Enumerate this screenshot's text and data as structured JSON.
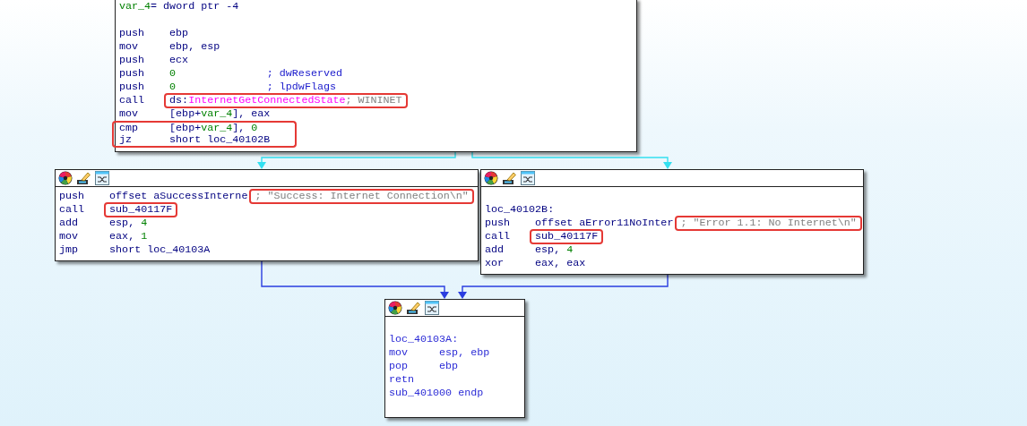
{
  "graph": {
    "blocks": [
      {
        "toolbar": false,
        "highlighted": false,
        "lines": [
          {
            "kind": "text",
            "tokens": [
              {
                "t": "var_4",
                "kind": "var"
              },
              {
                "t": "= dword ptr -4",
                "kind": "plain"
              }
            ]
          },
          {
            "kind": "blank"
          },
          {
            "kind": "instr",
            "mnemonic": "push",
            "operands": [
              {
                "t": "ebp",
                "kind": "plain"
              }
            ]
          },
          {
            "kind": "instr",
            "mnemonic": "mov",
            "operands": [
              {
                "t": "ebp, esp",
                "kind": "plain"
              }
            ]
          },
          {
            "kind": "instr",
            "mnemonic": "push",
            "operands": [
              {
                "t": "ecx",
                "kind": "plain"
              }
            ]
          },
          {
            "kind": "instr",
            "mnemonic": "push",
            "operands": [
              {
                "t": "0",
                "kind": "num"
              }
            ],
            "comment": {
              "t": "; dwReserved",
              "kind": "comment"
            }
          },
          {
            "kind": "instr",
            "mnemonic": "push",
            "operands": [
              {
                "t": "0",
                "kind": "num"
              }
            ],
            "comment": {
              "t": "; lpdwFlags",
              "kind": "comment"
            }
          },
          {
            "kind": "instr",
            "mnemonic": "call",
            "operands": [
              {
                "t": "ds:",
                "kind": "plain"
              },
              {
                "t": "InternetGetConnectedState",
                "kind": "import"
              }
            ],
            "comment": {
              "t": "; WININET",
              "kind": "gray"
            },
            "boxed_operands": true,
            "boxed_comment": true
          },
          {
            "kind": "instr",
            "mnemonic": "mov",
            "operands": [
              {
                "t": "[ebp+",
                "kind": "plain"
              },
              {
                "t": "var_4",
                "kind": "var"
              },
              {
                "t": "], eax",
                "kind": "plain"
              }
            ]
          },
          {
            "kind": "instr",
            "mnemonic": "cmp",
            "operands": [
              {
                "t": "[ebp+",
                "kind": "plain"
              },
              {
                "t": "var_4",
                "kind": "var"
              },
              {
                "t": "], ",
                "kind": "plain"
              },
              {
                "t": "0",
                "kind": "num"
              }
            ],
            "boxed_line": true
          },
          {
            "kind": "instr",
            "mnemonic": "jz",
            "operands": [
              {
                "t": "short loc_40102B",
                "kind": "plain"
              }
            ],
            "boxed_line": true
          }
        ]
      },
      {
        "toolbar": true,
        "highlighted": false,
        "lines": [
          {
            "kind": "instr",
            "mnemonic": "push",
            "operands": [
              {
                "t": "offset aSuccessInterne",
                "kind": "plain"
              }
            ],
            "comment": {
              "t": "; \"Success: Internet Connection\\n\"",
              "kind": "gray"
            },
            "boxed_comment": true
          },
          {
            "kind": "instr",
            "mnemonic": "call",
            "operands": [
              {
                "t": "sub_40117F",
                "kind": "plain"
              }
            ],
            "boxed_operands": true
          },
          {
            "kind": "instr",
            "mnemonic": "add",
            "operands": [
              {
                "t": "esp, ",
                "kind": "plain"
              },
              {
                "t": "4",
                "kind": "num"
              }
            ]
          },
          {
            "kind": "instr",
            "mnemonic": "mov",
            "operands": [
              {
                "t": "eax, ",
                "kind": "plain"
              },
              {
                "t": "1",
                "kind": "num"
              }
            ]
          },
          {
            "kind": "instr",
            "mnemonic": "jmp",
            "operands": [
              {
                "t": "short loc_40103A",
                "kind": "plain"
              }
            ]
          }
        ]
      },
      {
        "toolbar": true,
        "highlighted": false,
        "lines": [
          {
            "kind": "blank"
          },
          {
            "kind": "text",
            "tokens": [
              {
                "t": "loc_40102B:",
                "kind": "plain"
              }
            ]
          },
          {
            "kind": "instr",
            "mnemonic": "push",
            "operands": [
              {
                "t": "offset aError11NoInter",
                "kind": "plain"
              }
            ],
            "comment": {
              "t": "; \"Error 1.1: No Internet\\n\"",
              "kind": "gray"
            },
            "boxed_comment": true
          },
          {
            "kind": "instr",
            "mnemonic": "call",
            "operands": [
              {
                "t": "sub_40117F",
                "kind": "plain"
              }
            ],
            "boxed_operands": true
          },
          {
            "kind": "instr",
            "mnemonic": "add",
            "operands": [
              {
                "t": "esp, ",
                "kind": "plain"
              },
              {
                "t": "4",
                "kind": "num"
              }
            ]
          },
          {
            "kind": "instr",
            "mnemonic": "xor",
            "operands": [
              {
                "t": "eax, eax",
                "kind": "plain"
              }
            ]
          }
        ]
      },
      {
        "toolbar": true,
        "highlighted": true,
        "lines": [
          {
            "kind": "blank"
          },
          {
            "kind": "text",
            "tokens": [
              {
                "t": "loc_40103A:",
                "kind": "plain"
              }
            ]
          },
          {
            "kind": "instr",
            "mnemonic": "mov",
            "operands": [
              {
                "t": "esp, ebp",
                "kind": "plain"
              }
            ]
          },
          {
            "kind": "instr",
            "mnemonic": "pop",
            "operands": [
              {
                "t": "ebp",
                "kind": "plain"
              }
            ]
          },
          {
            "kind": "instr",
            "mnemonic": "retn"
          },
          {
            "kind": "text",
            "tokens": [
              {
                "t": "sub_401000 endp",
                "kind": "plain"
              }
            ]
          },
          {
            "kind": "blank"
          }
        ]
      }
    ],
    "edges": [
      {
        "kind": "conditional"
      },
      {
        "kind": "conditional"
      },
      {
        "kind": "unconditional"
      },
      {
        "kind": "unconditional"
      }
    ]
  }
}
